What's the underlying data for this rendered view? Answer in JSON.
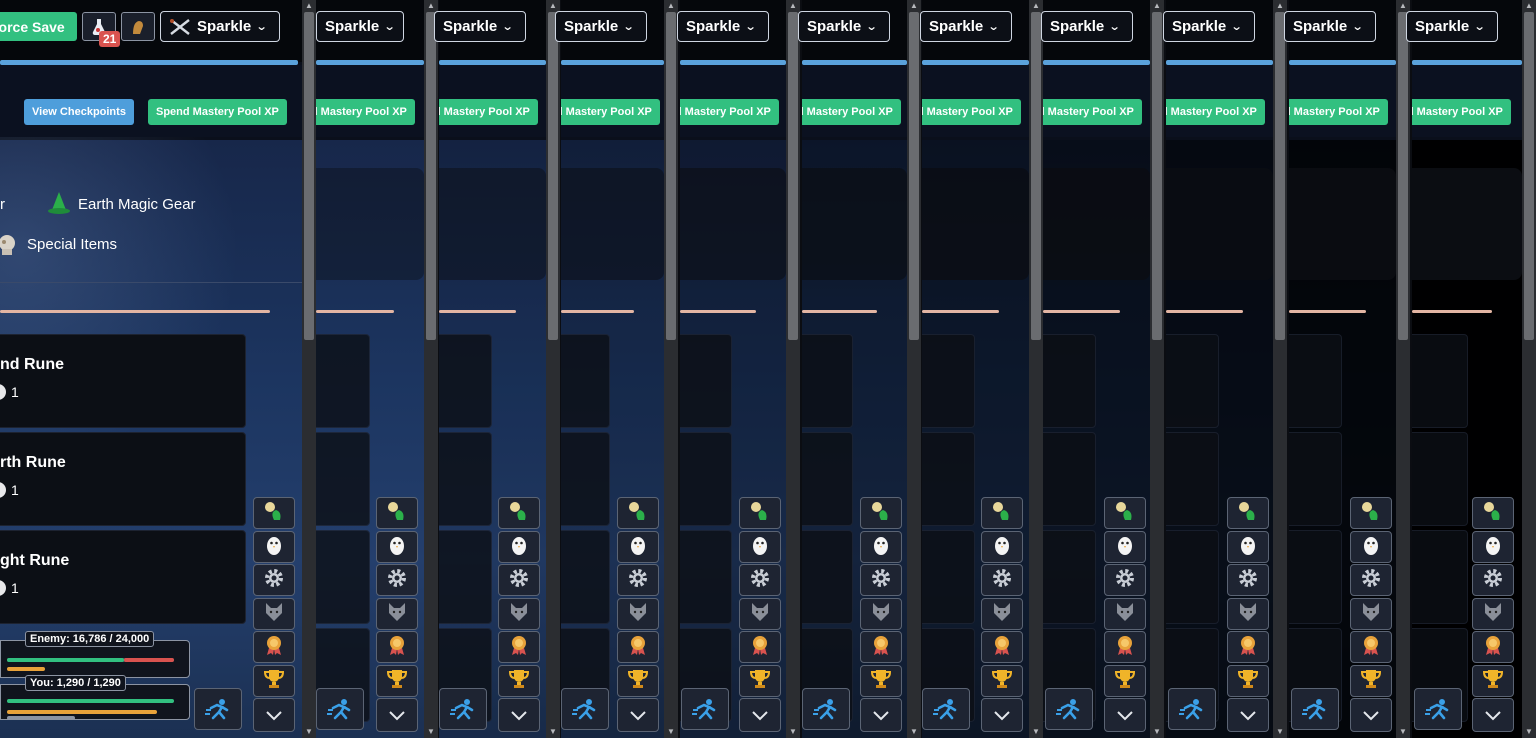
{
  "header": {
    "force_save_label": "Force Save",
    "notification_count": "21",
    "character_dropdown_label": "Sparkle"
  },
  "subheader": {
    "view_checkpoints_label": "View Checkpoints",
    "spend_mastery_label": "Spend Mastery Pool XP"
  },
  "categories": [
    {
      "label": "Earth Magic Gear",
      "icon": "wizard-hat-icon"
    },
    {
      "label": "Special Items",
      "icon": "special-items-icon"
    }
  ],
  "partial_category_label": "r",
  "runes": [
    {
      "name": "nd Rune",
      "qty": "1"
    },
    {
      "name": "rth Rune",
      "qty": "1"
    },
    {
      "name": "ght Rune",
      "qty": "1"
    }
  ],
  "combat": {
    "enemy_label": "Enemy: 16,786 / 24,000",
    "enemy_hp_fraction": 0.6994,
    "you_label": "You: 1,290 / 1,290",
    "you_hp_fraction": 1.0
  },
  "side_buttons": [
    "farming-icon",
    "penguin-icon",
    "gear-icon",
    "wolf-icon",
    "medal-icon",
    "trophy-icon",
    "chevron-down-icon"
  ],
  "colors": {
    "accent_green": "#32c080",
    "accent_blue": "#4e9edb",
    "progress_blue": "#5aa2dc",
    "notification_red": "#d9534f"
  }
}
